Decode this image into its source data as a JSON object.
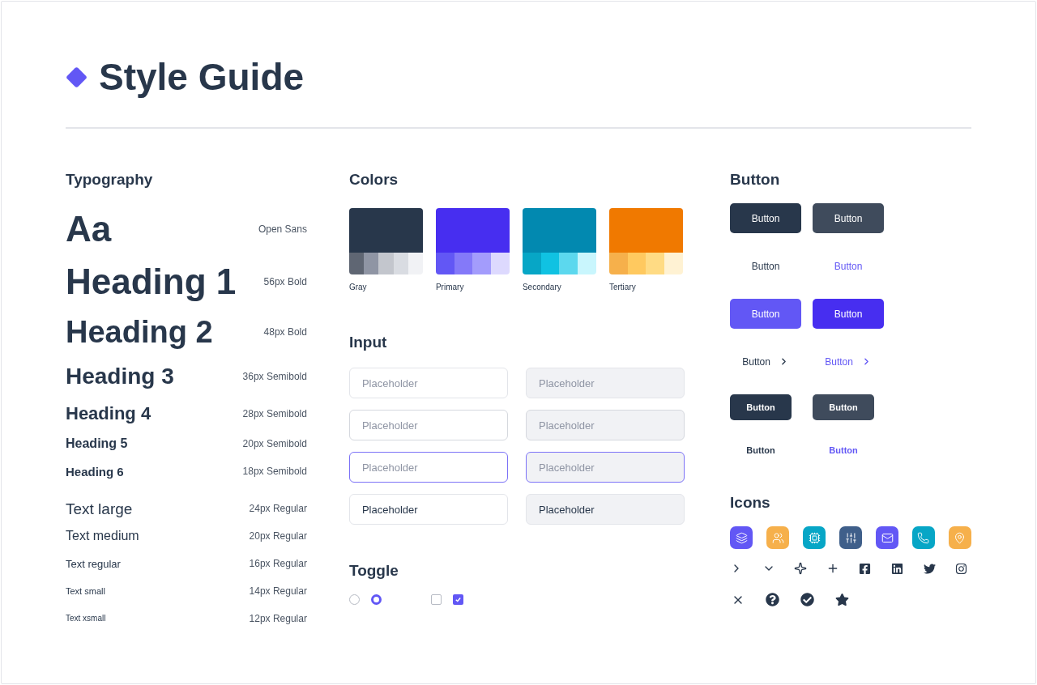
{
  "title": "Style Guide",
  "typography": {
    "heading": "Typography",
    "rows": [
      {
        "kind": "display",
        "sample": "Aa",
        "spec": "Open Sans"
      },
      {
        "kind": "h1",
        "sample": "Heading 1",
        "spec": "56px Bold"
      },
      {
        "kind": "h2",
        "sample": "Heading 2",
        "spec": "48px Bold"
      },
      {
        "kind": "h3",
        "sample": "Heading 3",
        "spec": "36px Semibold"
      },
      {
        "kind": "h4",
        "sample": "Heading 4",
        "spec": "28px Semibold"
      },
      {
        "kind": "h5",
        "sample": "Heading 5",
        "spec": "20px Semibold"
      },
      {
        "kind": "h6",
        "sample": "Heading 6",
        "spec": "18px Semibold"
      },
      {
        "kind": "large",
        "sample": "Text large",
        "spec": "24px Regular"
      },
      {
        "kind": "medium",
        "sample": "Text medium",
        "spec": "20px Regular"
      },
      {
        "kind": "regular",
        "sample": "Text regular",
        "spec": "16px Regular"
      },
      {
        "kind": "small",
        "sample": "Text small",
        "spec": "14px Regular"
      },
      {
        "kind": "xsmall",
        "sample": "Text xsmall",
        "spec": "12px Regular"
      }
    ]
  },
  "colors": {
    "heading": "Colors",
    "swatches": [
      {
        "name": "Gray",
        "color": "#28374b",
        "shades": [
          {
            "color": "#5f6673"
          },
          {
            "color": "#8f95a4"
          },
          {
            "color": "#c3c6cd"
          },
          {
            "color": "#d9dce2"
          },
          {
            "color": "#f1f2f5"
          }
        ]
      },
      {
        "name": "Primary",
        "color": "#472ef0",
        "shades": [
          {
            "color": "#6257f5"
          },
          {
            "color": "#8479f9"
          },
          {
            "color": "#a39cfc"
          },
          {
            "color": "#ddd9fe"
          }
        ]
      },
      {
        "name": "Secondary",
        "color": "#0289b0",
        "shades": [
          {
            "color": "#07a6c6"
          },
          {
            "color": "#10c2e2"
          },
          {
            "color": "#5cd8ee"
          },
          {
            "color": "#c9f6fd"
          }
        ]
      },
      {
        "name": "Tertiary",
        "color": "#f07900",
        "shades": [
          {
            "color": "#f6b04b"
          },
          {
            "color": "#ffc95f"
          },
          {
            "color": "#ffdb84"
          },
          {
            "color": "#fff2d3"
          }
        ]
      }
    ]
  },
  "input": {
    "heading": "Input",
    "fields": [
      {
        "kind": "outlined",
        "placeholder": "Placeholder",
        "focused": false
      },
      {
        "kind": "filled",
        "placeholder": "Placeholder",
        "focused": false
      },
      {
        "kind": "outlined-strong",
        "placeholder": "Placeholder",
        "focused": false
      },
      {
        "kind": "filled-strong",
        "placeholder": "Placeholder",
        "focused": false
      },
      {
        "kind": "outlined",
        "placeholder": "Placeholder",
        "focused": true
      },
      {
        "kind": "filled",
        "placeholder": "Placeholder",
        "focused": true
      },
      {
        "kind": "outlined",
        "value": "Placeholder",
        "focused": false
      },
      {
        "kind": "filled",
        "value": "Placeholder",
        "focused": false
      }
    ]
  },
  "toggle": {
    "heading": "Toggle",
    "radios": [
      {
        "selected": false
      },
      {
        "selected": true
      }
    ],
    "checkboxes": [
      {
        "checked": false
      },
      {
        "checked": true
      }
    ]
  },
  "buttons": {
    "heading": "Button",
    "items": [
      {
        "kind": "solid-dark",
        "label": "Button",
        "arrow": false
      },
      {
        "kind": "solid-slate",
        "label": "Button",
        "arrow": false
      },
      {
        "kind": "text-dark",
        "label": "Button",
        "arrow": false
      },
      {
        "kind": "text-primary",
        "label": "Button",
        "arrow": false
      },
      {
        "kind": "solid-primary-light",
        "label": "Button",
        "arrow": false
      },
      {
        "kind": "solid-primary",
        "label": "Button",
        "arrow": false
      },
      {
        "kind": "text-dark",
        "label": "Button",
        "arrow": true
      },
      {
        "kind": "text-primary",
        "label": "Button",
        "arrow": true
      },
      {
        "kind": "solid-dark-small",
        "label": "Button",
        "arrow": false
      },
      {
        "kind": "solid-slate-small",
        "label": "Button",
        "arrow": false
      },
      {
        "kind": "text-dark-small",
        "label": "Button",
        "arrow": false
      },
      {
        "kind": "text-primary-small",
        "label": "Button",
        "arrow": false
      }
    ]
  },
  "icons": {
    "heading": "Icons"
  }
}
